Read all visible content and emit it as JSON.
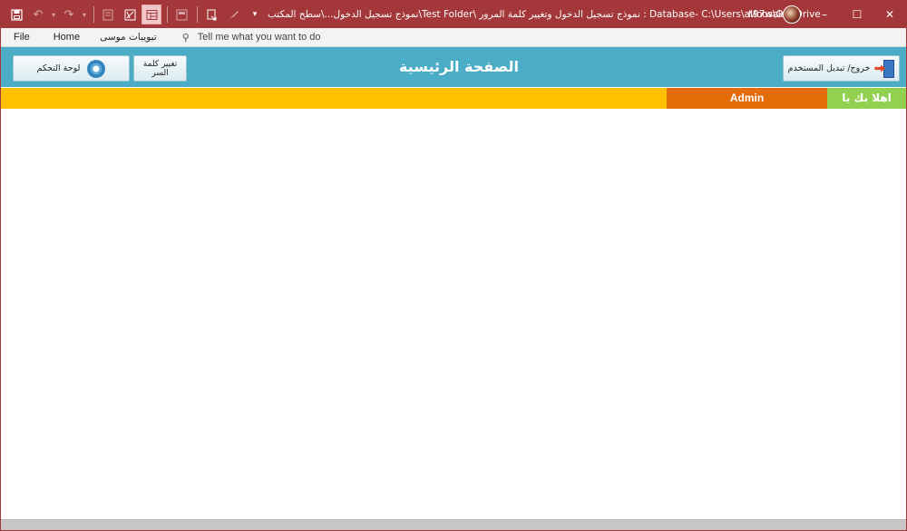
{
  "window": {
    "title": "نموذج تسجيل الدخول...\\سطح المكتب\\Test Folder\\ نموذج تسجيل الدخول وتغيير كلمة المرور : Database- C:\\Users\\al97w\\OneDrive",
    "user_name": "Moosak",
    "controls": {
      "minimize": "–",
      "maximize": "☐",
      "close": "✕"
    }
  },
  "quick_access": {
    "icons": [
      "save-icon",
      "undo-icon",
      "redo-icon",
      "form-view-icon",
      "report-icon",
      "datasheet-icon",
      "layout-icon",
      "design-view-icon",
      "brush-icon",
      "customize-dropdown-icon"
    ]
  },
  "ribbon": {
    "tabs": {
      "file": "File",
      "home": "Home",
      "custom": "تبويبات موسى"
    },
    "tell_me": "Tell me what you want to do"
  },
  "form": {
    "title": "الصفحة الرئيسية",
    "dashboard_button": "لوحة التحكم",
    "change_password_line1": "تغيير كلمة",
    "change_password_line2": "السر",
    "logout_button": "خروج/ تبديل المستخدم",
    "admin_label": "Admin",
    "welcome_label": "اهلا بك يا"
  },
  "colors": {
    "titlebar": "#a4373a",
    "header": "#4bacc6",
    "strip": "#ffc000",
    "admin_bg": "#e36c09",
    "welcome_bg": "#92d050"
  }
}
